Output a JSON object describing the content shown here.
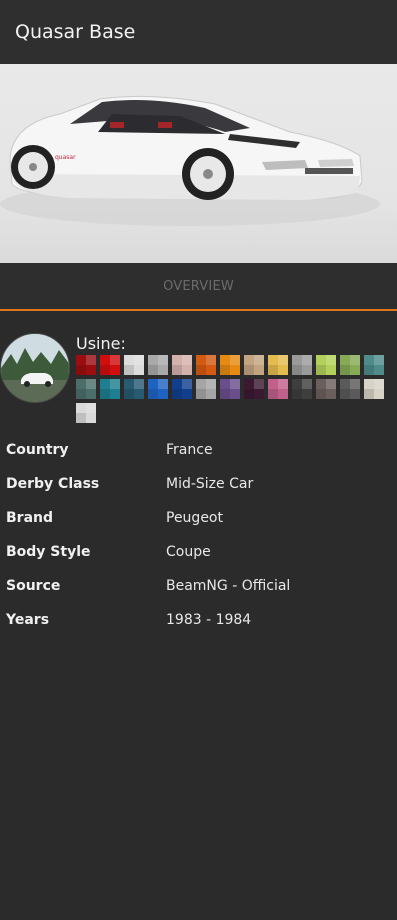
{
  "title": "Quasar Base",
  "tabs": [
    {
      "label": "OVERVIEW"
    }
  ],
  "config": {
    "name": "Usine:",
    "swatches": [
      "#9b0d10",
      "#d10d0e",
      "#dcdcdc",
      "#a9a9a9",
      "#d5b1ac",
      "#d45a12",
      "#e68a12",
      "#c2a481",
      "#e4bb4f",
      "#9a9a9a",
      "#b3d15a",
      "#86aa55",
      "#4f8b8b",
      "#4c6e6b",
      "#1d7f8f",
      "#285a74",
      "#1f63c2",
      "#123f8d",
      "#a5a5a5",
      "#6a4e8b",
      "#3b1a31",
      "#c1608a",
      "#3e3e3e",
      "#6b5f5c",
      "#5a5a5a",
      "#d8d2c7",
      "#dadada"
    ]
  },
  "details": [
    {
      "key": "Country",
      "value": "France"
    },
    {
      "key": "Derby Class",
      "value": "Mid-Size Car"
    },
    {
      "key": "Brand",
      "value": "Peugeot"
    },
    {
      "key": "Body Style",
      "value": "Coupe"
    },
    {
      "key": "Source",
      "value": "BeamNG - Official"
    },
    {
      "key": "Years",
      "value": "1983 - 1984"
    }
  ]
}
